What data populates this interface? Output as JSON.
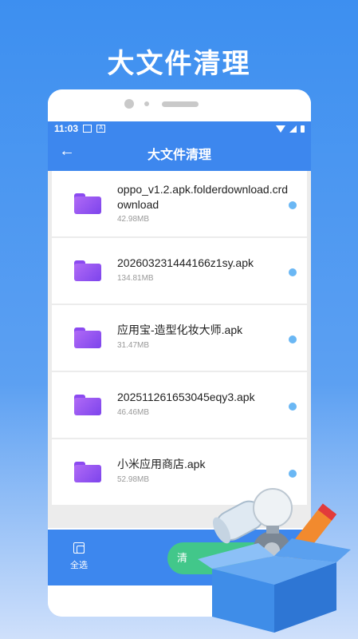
{
  "headline": "大文件清理",
  "statusbar": {
    "time": "11:03",
    "icon_a": "A"
  },
  "appbar": {
    "title": "大文件清理",
    "back_icon": "←"
  },
  "files": [
    {
      "name": "oppo_v1.2.apk.folderdownload.crdownload",
      "size": "42.98MB"
    },
    {
      "name": "202603231444166z1sy.apk",
      "size": "134.81MB"
    },
    {
      "name": "应用宝-造型化妆大师.apk",
      "size": "31.47MB"
    },
    {
      "name": "202511261653045eqy3.apk",
      "size": "46.46MB"
    },
    {
      "name": "小米应用商店.apk",
      "size": "52.98MB"
    }
  ],
  "bottombar": {
    "select_all": "全选",
    "clean_button": "清"
  },
  "colors": {
    "accent": "#3d87ee",
    "folder": "#8b4af0",
    "dot": "#6ab7f4",
    "clean": "#42c78a"
  },
  "icons": [
    "back-arrow-icon",
    "folder-icon",
    "select-all-icon",
    "wifi-icon",
    "signal-icon",
    "battery-icon",
    "toolbox-illustration"
  ]
}
